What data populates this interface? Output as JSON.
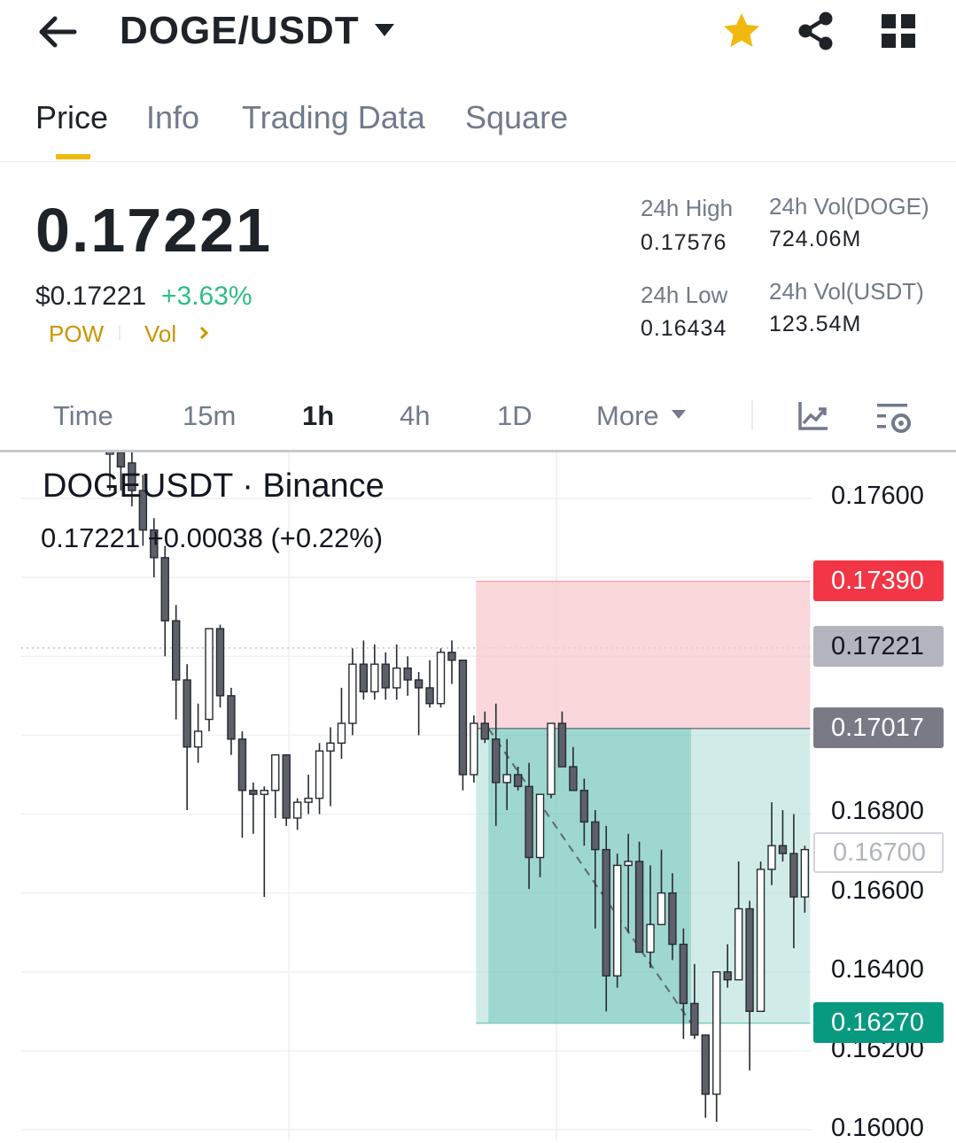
{
  "header": {
    "pair": "DOGE/USDT",
    "icons": [
      "back-arrow-icon",
      "caret-down-icon",
      "star-icon",
      "share-icon",
      "grid-icon"
    ],
    "favorite_color": "#f0b90b"
  },
  "tabs": [
    {
      "label": "Price",
      "active": true
    },
    {
      "label": "Info",
      "active": false
    },
    {
      "label": "Trading Data",
      "active": false
    },
    {
      "label": "Square",
      "active": false
    }
  ],
  "summary": {
    "last_price": "0.17221",
    "usd_price": "$0.17221",
    "change_pct": "+3.63%",
    "tag_pow": "POW",
    "tag_vol": "Vol",
    "stats": {
      "high_label": "24h High",
      "high_value": "0.17576",
      "low_label": "24h Low",
      "low_value": "0.16434",
      "vol_base_label": "24h Vol(DOGE)",
      "vol_base_value": "724.06M",
      "vol_quote_label": "24h Vol(USDT)",
      "vol_quote_value": "123.54M"
    },
    "up_color": "#2ebd85"
  },
  "intervals": [
    {
      "label": "Time",
      "active": false
    },
    {
      "label": "15m",
      "active": false
    },
    {
      "label": "1h",
      "active": true
    },
    {
      "label": "4h",
      "active": false
    },
    {
      "label": "1D",
      "active": false
    },
    {
      "label": "More",
      "active": false
    }
  ],
  "chart": {
    "title": "DOGEUSDT · Binance",
    "ohlc_line": "0.17221 +0.00038 (+0.22%)",
    "badges": {
      "stop_loss": "0.17390",
      "current": "0.17221",
      "entry": "0.17017",
      "hover": "0.16700",
      "take_profit": "0.16270"
    },
    "badge_colors": {
      "stop_loss": "#f23645",
      "current": "#b2b5be",
      "entry": "#787b86",
      "take_profit": "#089981"
    }
  },
  "chart_data": {
    "type": "candlestick",
    "yticks": [
      "0.17600",
      "0.16800",
      "0.16600",
      "0.16400",
      "0.16200",
      "0.16000"
    ],
    "ylim": [
      0.16,
      0.176
    ],
    "grid": true,
    "position_tool": {
      "side": "short",
      "stop_loss": 0.1739,
      "entry": 0.17017,
      "take_profit": 0.1627,
      "start_index": 34,
      "end_index": 63
    },
    "candles": [
      {
        "o": 0.1772,
        "h": 0.178,
        "l": 0.1762,
        "c": 0.1775
      },
      {
        "o": 0.1775,
        "h": 0.1778,
        "l": 0.1762,
        "c": 0.1768
      },
      {
        "o": 0.1769,
        "h": 0.1774,
        "l": 0.1758,
        "c": 0.1762
      },
      {
        "o": 0.1762,
        "h": 0.1766,
        "l": 0.1748,
        "c": 0.1752
      },
      {
        "o": 0.1752,
        "h": 0.1755,
        "l": 0.174,
        "c": 0.1745
      },
      {
        "o": 0.1745,
        "h": 0.1748,
        "l": 0.172,
        "c": 0.1729
      },
      {
        "o": 0.1729,
        "h": 0.1733,
        "l": 0.1704,
        "c": 0.1714
      },
      {
        "o": 0.1714,
        "h": 0.1718,
        "l": 0.1681,
        "c": 0.1697
      },
      {
        "o": 0.1697,
        "h": 0.1708,
        "l": 0.1693,
        "c": 0.1701
      },
      {
        "o": 0.1704,
        "h": 0.1727,
        "l": 0.1701,
        "c": 0.1727
      },
      {
        "o": 0.1727,
        "h": 0.1728,
        "l": 0.1707,
        "c": 0.171
      },
      {
        "o": 0.171,
        "h": 0.1712,
        "l": 0.1695,
        "c": 0.1699
      },
      {
        "o": 0.1699,
        "h": 0.1701,
        "l": 0.1674,
        "c": 0.1686
      },
      {
        "o": 0.1686,
        "h": 0.1688,
        "l": 0.1675,
        "c": 0.1685
      },
      {
        "o": 0.1685,
        "h": 0.1687,
        "l": 0.1659,
        "c": 0.1686
      },
      {
        "o": 0.1686,
        "h": 0.1695,
        "l": 0.1679,
        "c": 0.1695
      },
      {
        "o": 0.1695,
        "h": 0.1695,
        "l": 0.1677,
        "c": 0.1679
      },
      {
        "o": 0.1679,
        "h": 0.1684,
        "l": 0.1676,
        "c": 0.1683
      },
      {
        "o": 0.1683,
        "h": 0.169,
        "l": 0.168,
        "c": 0.1684
      },
      {
        "o": 0.1684,
        "h": 0.1698,
        "l": 0.168,
        "c": 0.1696
      },
      {
        "o": 0.1696,
        "h": 0.1702,
        "l": 0.1682,
        "c": 0.1698
      },
      {
        "o": 0.1698,
        "h": 0.1712,
        "l": 0.1694,
        "c": 0.1703
      },
      {
        "o": 0.1703,
        "h": 0.1722,
        "l": 0.17,
        "c": 0.1718
      },
      {
        "o": 0.1718,
        "h": 0.1724,
        "l": 0.1709,
        "c": 0.1711
      },
      {
        "o": 0.1711,
        "h": 0.1723,
        "l": 0.1709,
        "c": 0.1718
      },
      {
        "o": 0.1718,
        "h": 0.1721,
        "l": 0.1709,
        "c": 0.1712
      },
      {
        "o": 0.1712,
        "h": 0.1723,
        "l": 0.1709,
        "c": 0.1717
      },
      {
        "o": 0.1717,
        "h": 0.172,
        "l": 0.171,
        "c": 0.1714
      },
      {
        "o": 0.1714,
        "h": 0.1716,
        "l": 0.17,
        "c": 0.1712
      },
      {
        "o": 0.1712,
        "h": 0.1719,
        "l": 0.1707,
        "c": 0.1708
      },
      {
        "o": 0.1708,
        "h": 0.1722,
        "l": 0.1707,
        "c": 0.1721
      },
      {
        "o": 0.1721,
        "h": 0.1724,
        "l": 0.1713,
        "c": 0.1719
      },
      {
        "o": 0.1719,
        "h": 0.1719,
        "l": 0.1686,
        "c": 0.169
      },
      {
        "o": 0.169,
        "h": 0.1705,
        "l": 0.1688,
        "c": 0.1703
      },
      {
        "o": 0.1703,
        "h": 0.1706,
        "l": 0.1698,
        "c": 0.1699
      },
      {
        "o": 0.1699,
        "h": 0.1708,
        "l": 0.1677,
        "c": 0.1688
      },
      {
        "o": 0.1688,
        "h": 0.1699,
        "l": 0.1681,
        "c": 0.169
      },
      {
        "o": 0.169,
        "h": 0.1692,
        "l": 0.1686,
        "c": 0.1687
      },
      {
        "o": 0.1687,
        "h": 0.1693,
        "l": 0.1661,
        "c": 0.1669
      },
      {
        "o": 0.1669,
        "h": 0.1684,
        "l": 0.1664,
        "c": 0.1685
      },
      {
        "o": 0.1685,
        "h": 0.1703,
        "l": 0.1684,
        "c": 0.1703
      },
      {
        "o": 0.1703,
        "h": 0.1706,
        "l": 0.1692,
        "c": 0.1692
      },
      {
        "o": 0.1692,
        "h": 0.1697,
        "l": 0.1686,
        "c": 0.1686
      },
      {
        "o": 0.1686,
        "h": 0.1689,
        "l": 0.1672,
        "c": 0.1678
      },
      {
        "o": 0.1678,
        "h": 0.1681,
        "l": 0.1651,
        "c": 0.1671
      },
      {
        "o": 0.1671,
        "h": 0.1677,
        "l": 0.163,
        "c": 0.1639
      },
      {
        "o": 0.1639,
        "h": 0.167,
        "l": 0.1636,
        "c": 0.1667
      },
      {
        "o": 0.1667,
        "h": 0.1675,
        "l": 0.165,
        "c": 0.1668
      },
      {
        "o": 0.1668,
        "h": 0.1673,
        "l": 0.1646,
        "c": 0.1645
      },
      {
        "o": 0.1645,
        "h": 0.1667,
        "l": 0.1641,
        "c": 0.1652
      },
      {
        "o": 0.1652,
        "h": 0.1671,
        "l": 0.1652,
        "c": 0.166
      },
      {
        "o": 0.166,
        "h": 0.1665,
        "l": 0.1643,
        "c": 0.1647
      },
      {
        "o": 0.1647,
        "h": 0.1651,
        "l": 0.1623,
        "c": 0.1632
      },
      {
        "o": 0.1632,
        "h": 0.1642,
        "l": 0.1623,
        "c": 0.1624
      },
      {
        "o": 0.1624,
        "h": 0.1624,
        "l": 0.1603,
        "c": 0.1609
      },
      {
        "o": 0.1609,
        "h": 0.164,
        "l": 0.1602,
        "c": 0.164
      },
      {
        "o": 0.164,
        "h": 0.1647,
        "l": 0.1636,
        "c": 0.1638
      },
      {
        "o": 0.1638,
        "h": 0.1668,
        "l": 0.1641,
        "c": 0.1656
      },
      {
        "o": 0.1656,
        "h": 0.1658,
        "l": 0.1615,
        "c": 0.163
      },
      {
        "o": 0.163,
        "h": 0.1668,
        "l": 0.163,
        "c": 0.1666
      },
      {
        "o": 0.1666,
        "h": 0.1683,
        "l": 0.1662,
        "c": 0.1672
      },
      {
        "o": 0.1672,
        "h": 0.1681,
        "l": 0.1668,
        "c": 0.167
      },
      {
        "o": 0.167,
        "h": 0.168,
        "l": 0.1646,
        "c": 0.1659
      },
      {
        "o": 0.1659,
        "h": 0.1672,
        "l": 0.1655,
        "c": 0.1671
      }
    ]
  }
}
